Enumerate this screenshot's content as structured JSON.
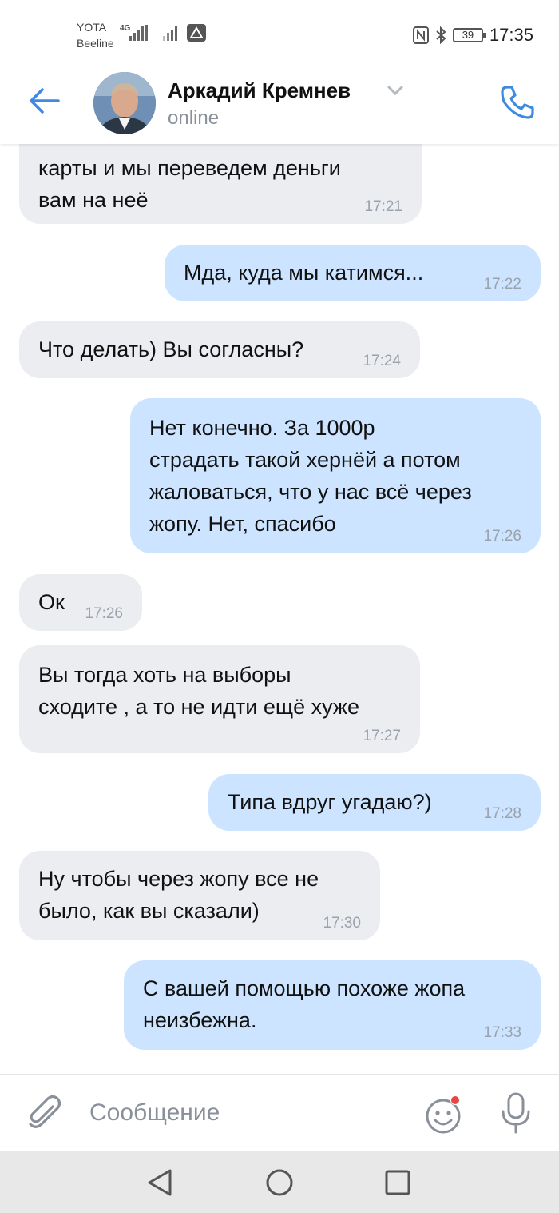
{
  "status_bar": {
    "carrier1": "YOTA",
    "carrier2": "Beeline",
    "network": "4G",
    "battery": "39",
    "time": "17:35"
  },
  "header": {
    "name": "Аркадий Кремнев",
    "status": "online",
    "accent_color": "#3f8ae0"
  },
  "messages": [
    {
      "dir": "in",
      "text": "карты и мы переведем деньги\nвам на неё",
      "time": "17:21"
    },
    {
      "dir": "out",
      "text": "Мда, куда мы катимся...",
      "time": "17:22"
    },
    {
      "dir": "in",
      "text": "Что делать) Вы согласны?",
      "time": "17:24"
    },
    {
      "dir": "out",
      "text": "Нет конечно. За 1000р\nстрадать такой хернёй а потом\nжаловаться, что у нас всё через\nжопу. Нет, спасибо",
      "time": "17:26"
    },
    {
      "dir": "in",
      "text": "Ок",
      "time": "17:26"
    },
    {
      "dir": "in",
      "text": "Вы тогда хоть на выборы\nсходите , а то не идти ещё хуже",
      "time": "17:27"
    },
    {
      "dir": "out",
      "text": "Типа вдруг угадаю?)",
      "time": "17:28"
    },
    {
      "dir": "in",
      "text": "Ну чтобы через жопу все не\nбыло, как вы сказали)",
      "time": "17:30"
    },
    {
      "dir": "out",
      "text": "С вашей помощью похоже жопа\nнеизбежна.",
      "time": "17:33"
    }
  ],
  "composer": {
    "placeholder": "Сообщение"
  },
  "icons": [
    "back-arrow-icon",
    "phone-icon",
    "paperclip-icon",
    "emoji-icon",
    "microphone-icon",
    "nav-back-icon",
    "nav-home-icon",
    "nav-recents-icon"
  ]
}
